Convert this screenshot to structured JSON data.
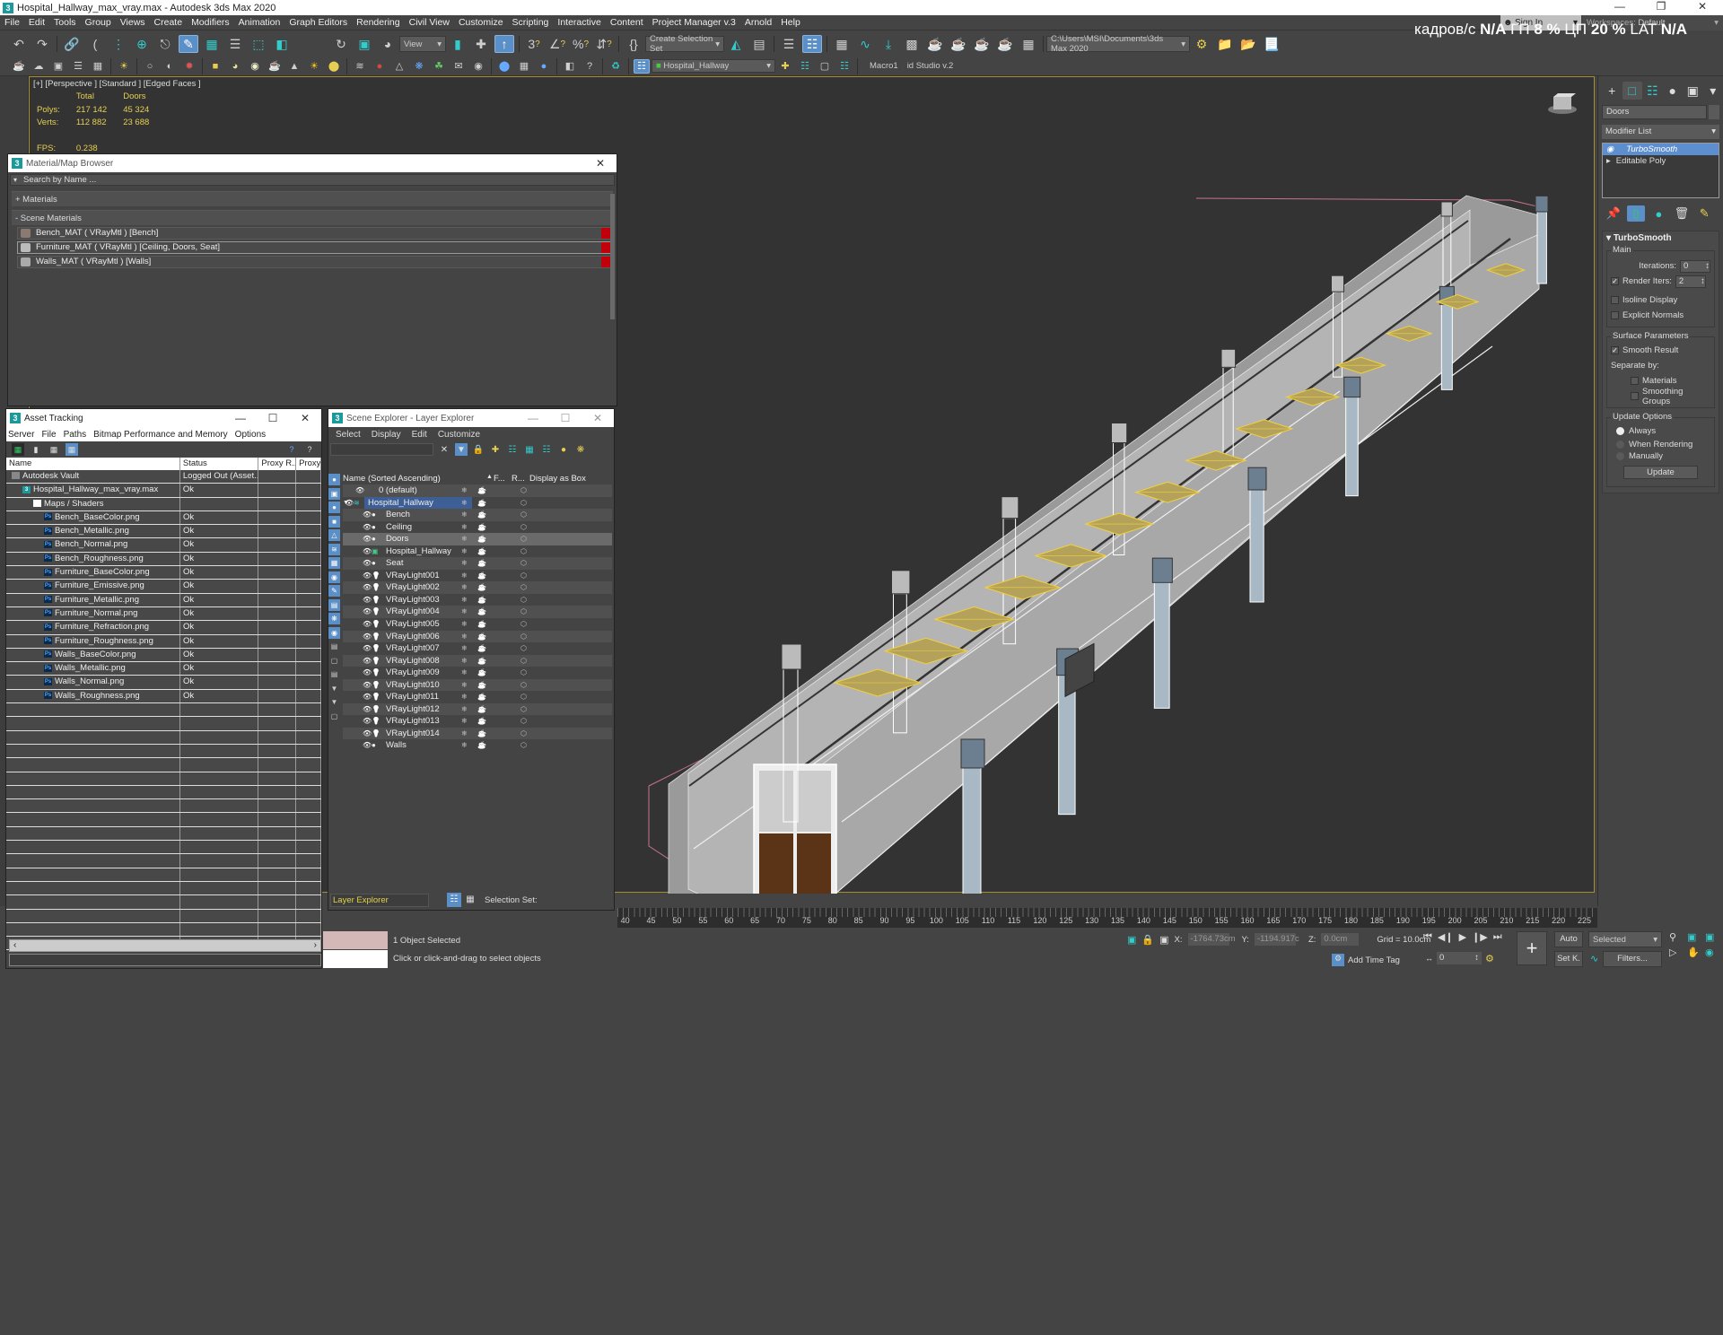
{
  "app": {
    "title": "Hospital_Hallway_max_vray.max - Autodesk 3ds Max 2020",
    "logo": "3",
    "window_buttons": [
      "minimize-icon",
      "restore-icon",
      "close-icon"
    ]
  },
  "menubar": {
    "items": [
      "File",
      "Edit",
      "Tools",
      "Group",
      "Views",
      "Create",
      "Modifiers",
      "Animation",
      "Graph Editors",
      "Rendering",
      "Civil View",
      "Customize",
      "Scripting",
      "Interactive",
      "Content",
      "Project Manager v.3",
      "Arnold",
      "Help"
    ],
    "sign_in": "Sign In",
    "workspaces_label": "Workspaces:",
    "workspaces_value": "Default"
  },
  "perf_overlay": {
    "fps_label": "кадров/с",
    "fps_value": "N/A",
    "gpu_label": "ГП",
    "gpu_value": "8 %",
    "cpu_label": "ЦП",
    "cpu_value": "20 %",
    "lat_label": "LAT",
    "lat_value": "N/A"
  },
  "toolbar": {
    "view_dropdown": "View",
    "selection_set": "Create Selection Set",
    "project_path": "C:\\Users\\MSI\\Documents\\3ds Max 2020",
    "layer_dropdown": "Hospital_Hallway",
    "macro1": "Macro1",
    "studio": "id Studio v.2"
  },
  "viewport": {
    "label": "[+] [Perspective ] [Standard ] [Edged Faces ]",
    "stats": {
      "col_total": "Total",
      "col_sel": "Doors",
      "polys_label": "Polys:",
      "polys_total": "217 142",
      "polys_sel": "45 324",
      "verts_label": "Verts:",
      "verts_total": "112 882",
      "verts_sel": "23 688",
      "fps_label": "FPS:",
      "fps_value": "0.238"
    }
  },
  "material_browser": {
    "title": "Material/Map Browser",
    "search_placeholder": "Search by Name ...",
    "sections": [
      {
        "label": "+ Materials"
      },
      {
        "label": "- Scene Materials"
      }
    ],
    "items": [
      {
        "label": "Bench_MAT  ( VRayMtl ) [Bench]"
      },
      {
        "label": "Furniture_MAT  ( VRayMtl ) [Ceiling, Doors, Seat]"
      },
      {
        "label": "Walls_MAT  ( VRayMtl ) [Walls]"
      }
    ]
  },
  "asset_tracking": {
    "title": "Asset Tracking",
    "menu": [
      "Server",
      "File",
      "Paths",
      "Bitmap Performance and Memory",
      "Options"
    ],
    "columns": [
      "Name",
      "Status",
      "Proxy R...",
      "Proxy"
    ],
    "rows": [
      {
        "name": "Autodesk Vault",
        "status": "Logged Out (Asset...",
        "indent": 0,
        "icon": "vault-icon"
      },
      {
        "name": "Hospital_Hallway_max_vray.max",
        "status": "Ok",
        "indent": 1,
        "icon": "max-file-icon"
      },
      {
        "name": "Maps / Shaders",
        "status": "",
        "indent": 2,
        "icon": "folder-icon"
      },
      {
        "name": "Bench_BaseColor.png",
        "status": "Ok",
        "indent": 3,
        "icon": "ps-icon"
      },
      {
        "name": "Bench_Metallic.png",
        "status": "Ok",
        "indent": 3,
        "icon": "ps-icon"
      },
      {
        "name": "Bench_Normal.png",
        "status": "Ok",
        "indent": 3,
        "icon": "ps-icon"
      },
      {
        "name": "Bench_Roughness.png",
        "status": "Ok",
        "indent": 3,
        "icon": "ps-icon"
      },
      {
        "name": "Furniture_BaseColor.png",
        "status": "Ok",
        "indent": 3,
        "icon": "ps-icon"
      },
      {
        "name": "Furniture_Emissive.png",
        "status": "Ok",
        "indent": 3,
        "icon": "ps-icon"
      },
      {
        "name": "Furniture_Metallic.png",
        "status": "Ok",
        "indent": 3,
        "icon": "ps-icon"
      },
      {
        "name": "Furniture_Normal.png",
        "status": "Ok",
        "indent": 3,
        "icon": "ps-icon"
      },
      {
        "name": "Furniture_Refraction.png",
        "status": "Ok",
        "indent": 3,
        "icon": "ps-icon"
      },
      {
        "name": "Furniture_Roughness.png",
        "status": "Ok",
        "indent": 3,
        "icon": "ps-icon"
      },
      {
        "name": "Walls_BaseColor.png",
        "status": "Ok",
        "indent": 3,
        "icon": "ps-icon"
      },
      {
        "name": "Walls_Metallic.png",
        "status": "Ok",
        "indent": 3,
        "icon": "ps-icon"
      },
      {
        "name": "Walls_Normal.png",
        "status": "Ok",
        "indent": 3,
        "icon": "ps-icon"
      },
      {
        "name": "Walls_Roughness.png",
        "status": "Ok",
        "indent": 3,
        "icon": "ps-icon"
      }
    ]
  },
  "scene_explorer": {
    "title": "Scene Explorer - Layer Explorer",
    "menu": [
      "Select",
      "Display",
      "Edit",
      "Customize"
    ],
    "columns": [
      "Name (Sorted Ascending)",
      "F...",
      "R...",
      "Display as Box"
    ],
    "rows": [
      {
        "name": "0 (default)",
        "type": "layer",
        "level": 1,
        "selected": false
      },
      {
        "name": "Hospital_Hallway",
        "type": "layer-open",
        "level": 0,
        "selected": true
      },
      {
        "name": "Bench",
        "type": "object",
        "level": 2,
        "selected": false
      },
      {
        "name": "Ceiling",
        "type": "object",
        "level": 2,
        "selected": false
      },
      {
        "name": "Doors",
        "type": "object",
        "level": 2,
        "selected": false,
        "highlight": true
      },
      {
        "name": "Hospital_Hallway",
        "type": "group",
        "level": 2,
        "selected": false
      },
      {
        "name": "Seat",
        "type": "object",
        "level": 2,
        "selected": false
      },
      {
        "name": "VRayLight001",
        "type": "light",
        "level": 2
      },
      {
        "name": "VRayLight002",
        "type": "light",
        "level": 2
      },
      {
        "name": "VRayLight003",
        "type": "light",
        "level": 2
      },
      {
        "name": "VRayLight004",
        "type": "light",
        "level": 2
      },
      {
        "name": "VRayLight005",
        "type": "light",
        "level": 2
      },
      {
        "name": "VRayLight006",
        "type": "light",
        "level": 2
      },
      {
        "name": "VRayLight007",
        "type": "light",
        "level": 2
      },
      {
        "name": "VRayLight008",
        "type": "light",
        "level": 2
      },
      {
        "name": "VRayLight009",
        "type": "light",
        "level": 2
      },
      {
        "name": "VRayLight010",
        "type": "light",
        "level": 2
      },
      {
        "name": "VRayLight011",
        "type": "light",
        "level": 2
      },
      {
        "name": "VRayLight012",
        "type": "light",
        "level": 2
      },
      {
        "name": "VRayLight013",
        "type": "light",
        "level": 2
      },
      {
        "name": "VRayLight014",
        "type": "light",
        "level": 2
      },
      {
        "name": "Walls",
        "type": "object",
        "level": 2
      }
    ],
    "footer_explorer": "Layer Explorer",
    "selection_set_label": "Selection Set:"
  },
  "command_panel": {
    "object_name": "Doors",
    "modifier_list": "Modifier List",
    "stack": [
      "TurboSmooth",
      "Editable Poly"
    ],
    "rollout_title": "TurboSmooth",
    "main_group": "Main",
    "iterations_label": "Iterations:",
    "iterations_value": "0",
    "render_iters_label": "Render Iters:",
    "render_iters_value": "2",
    "render_iters_checked": true,
    "isoline_label": "Isoline Display",
    "isoline_checked": false,
    "explicit_normals_label": "Explicit Normals",
    "explicit_normals_checked": false,
    "surface_group": "Surface Parameters",
    "smooth_result_label": "Smooth Result",
    "smooth_result_checked": true,
    "separate_by_label": "Separate by:",
    "materials_label": "Materials",
    "materials_checked": false,
    "smoothing_groups_label": "Smoothing Groups",
    "smoothing_groups_checked": false,
    "update_group": "Update Options",
    "update_options": [
      "Always",
      "When Rendering",
      "Manually"
    ],
    "update_selected": "Always",
    "update_button": "Update"
  },
  "timeline": {
    "ticks": [
      40,
      45,
      50,
      55,
      60,
      65,
      70,
      75,
      80,
      85,
      90,
      95,
      100,
      105,
      110,
      115,
      120,
      125,
      130,
      135,
      140,
      145,
      150,
      155,
      160,
      165,
      170,
      175,
      180,
      185,
      190,
      195,
      200,
      205,
      210,
      215,
      220,
      225
    ],
    "range_start": 40,
    "range_end": 225
  },
  "statusbar": {
    "selection": "1 Object Selected",
    "prompt": "Click or click-and-drag to select objects",
    "x_label": "X:",
    "x_value": "-1764.73cm",
    "y_label": "Y:",
    "y_value": "-1194.917c",
    "z_label": "Z:",
    "z_value": "0.0cm",
    "grid": "Grid = 10.0cm",
    "add_time_tag": "Add Time Tag",
    "frame": "0",
    "auto": "Auto",
    "set_key": "Set K.",
    "key_filter": "Selected",
    "filters": "Filters..."
  },
  "colors": {
    "accent_blue": "#5b8fc7",
    "viewport_border": "#a88e2e",
    "stats_yellow": "#e7cf52",
    "material_flag": "#c0000b",
    "layer_explorer_text": "#e0d24a"
  }
}
